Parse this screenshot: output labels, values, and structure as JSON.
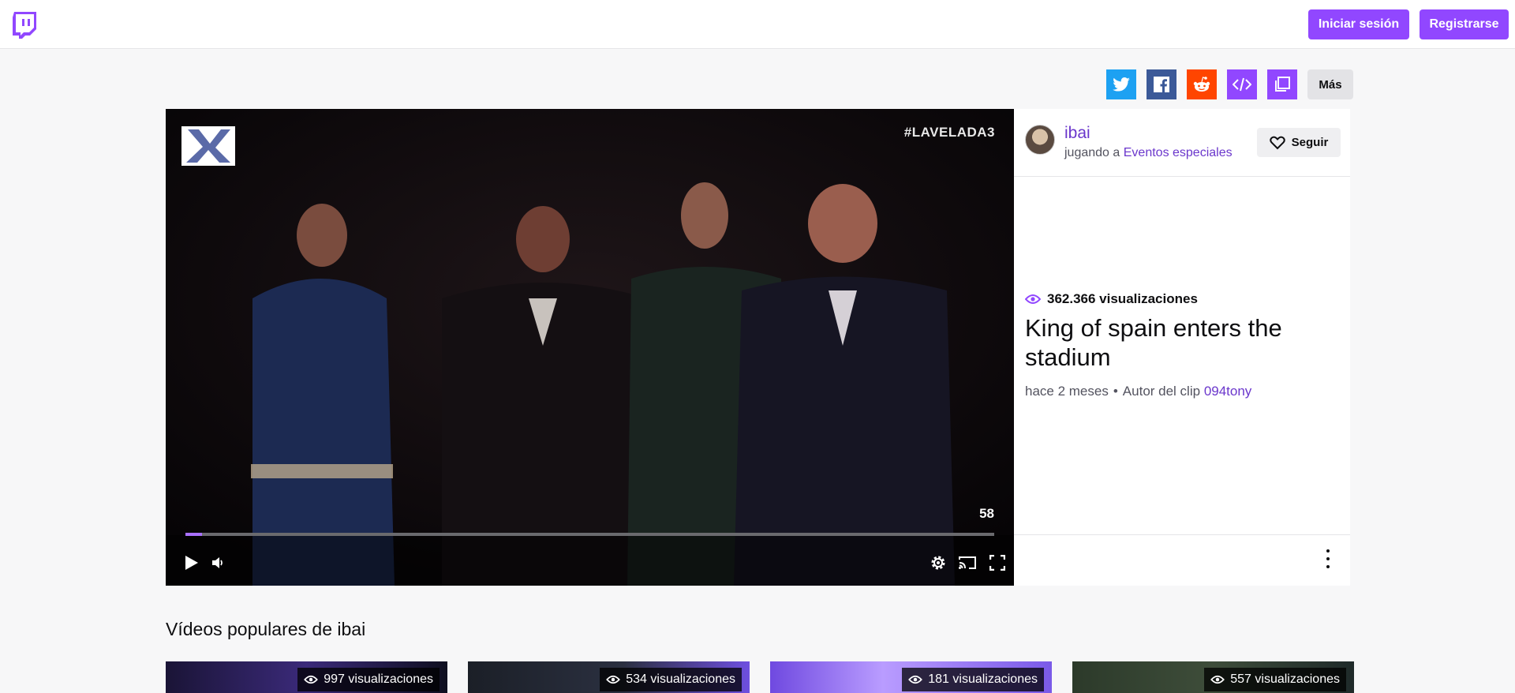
{
  "header": {
    "login_label": "Iniciar sesión",
    "register_label": "Registrarse",
    "brand_color": "#9147ff"
  },
  "share": {
    "buttons": [
      {
        "name": "twitter",
        "icon": "twitter-icon",
        "color": "#1da1f2"
      },
      {
        "name": "facebook",
        "icon": "facebook-icon",
        "color": "#3b5998"
      },
      {
        "name": "reddit",
        "icon": "reddit-icon",
        "color": "#ff4500"
      },
      {
        "name": "embed",
        "icon": "code-icon",
        "color": "#9147ff"
      },
      {
        "name": "copy",
        "icon": "copy-icon",
        "color": "#9147ff"
      }
    ],
    "more_label": "Más"
  },
  "player": {
    "hashtag": "#LAVELADA3",
    "time_display": "58",
    "progress_fraction": 0.02
  },
  "clip": {
    "channel_name": "ibai",
    "playing_prefix": "jugando a",
    "game_name": "Eventos especiales",
    "follow_label": "Seguir",
    "views": "362.366 visualizaciones",
    "title": "King of spain enters the stadium",
    "age": "hace 2 meses",
    "author_prefix": "Autor del clip",
    "author": "094tony"
  },
  "popular": {
    "title": "Vídeos populares de ibai",
    "items": [
      {
        "views": "997 visualizaciones"
      },
      {
        "views": "534 visualizaciones"
      },
      {
        "views": "181 visualizaciones"
      },
      {
        "views": "557 visualizaciones"
      }
    ]
  }
}
